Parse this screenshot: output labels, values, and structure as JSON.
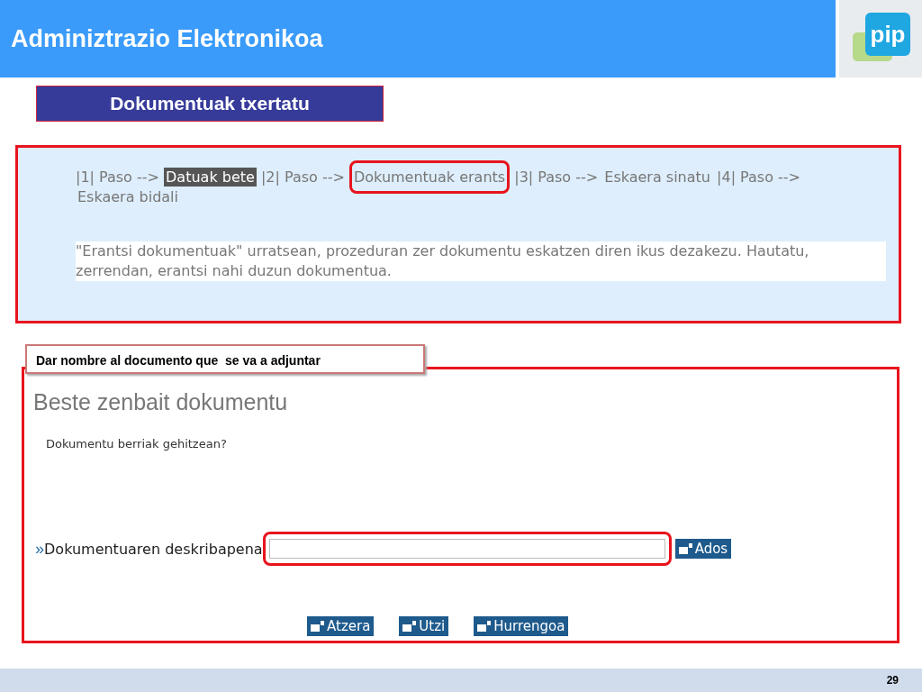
{
  "header": {
    "title": "Adminiztrazio Elektronikoa",
    "logo_text": "pip"
  },
  "section_title": "Dokumentuak txertatu",
  "steps_panel": {
    "steps": [
      {
        "prefix": "|1| Paso -->",
        "name": "Datuak bete",
        "selected": true,
        "highlighted": false
      },
      {
        "prefix": "|2| Paso -->",
        "name": "Dokumentuak erants",
        "selected": false,
        "highlighted": true
      },
      {
        "prefix": "|3| Paso -->",
        "name": "Eskaera sinatu",
        "selected": false,
        "highlighted": false
      },
      {
        "prefix": "|4| Paso -->",
        "name": "Eskaera bidali",
        "selected": false,
        "highlighted": false
      }
    ],
    "description": "\"Erantsi dokumentuak\" urratsean, prozeduran zer dokumentu eskatzen diren ikus dezakezu. Hautatu, zerrendan, erantsi nahi duzun dokumentua."
  },
  "note": "Dar nombre al documento que  se va a adjuntar",
  "form": {
    "heading": "Beste zenbait dokumentu",
    "question": "Dokumentu berriak gehitzean?",
    "field": {
      "marker": "»",
      "label": "Dokumentuaren deskribapena",
      "highlighted": true,
      "button": "Ados"
    },
    "buttons": [
      "Atzera",
      "Utzi",
      "Hurrengoa"
    ]
  },
  "footer": {
    "page_number": "29"
  }
}
